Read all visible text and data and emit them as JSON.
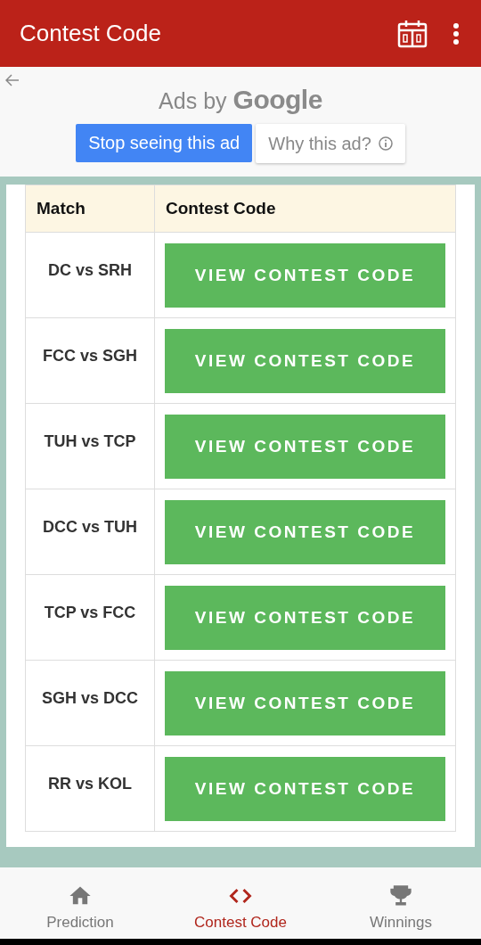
{
  "app_bar": {
    "title": "Contest Code"
  },
  "ad": {
    "label_prefix": "Ads by",
    "label_brand": "Google",
    "stop_button": "Stop seeing this ad",
    "why_button": "Why this ad?"
  },
  "table": {
    "columns": [
      "Match",
      "Contest Code"
    ],
    "rows": [
      {
        "match": "DC vs SRH",
        "button": "VIEW CONTEST CODE"
      },
      {
        "match": "FCC vs SGH",
        "button": "VIEW CONTEST CODE"
      },
      {
        "match": "TUH vs TCP",
        "button": "VIEW CONTEST CODE"
      },
      {
        "match": "DCC vs TUH",
        "button": "VIEW CONTEST CODE"
      },
      {
        "match": "TCP vs FCC",
        "button": "VIEW CONTEST CODE"
      },
      {
        "match": "SGH vs DCC",
        "button": "VIEW CONTEST CODE"
      },
      {
        "match": "RR vs KOL",
        "button": "VIEW CONTEST CODE"
      }
    ]
  },
  "bottom_nav": [
    {
      "label": "Prediction",
      "kind": "home",
      "selected": false
    },
    {
      "label": "Contest Code",
      "kind": "code",
      "selected": true
    },
    {
      "label": "Winnings",
      "kind": "trophy",
      "selected": false
    }
  ]
}
